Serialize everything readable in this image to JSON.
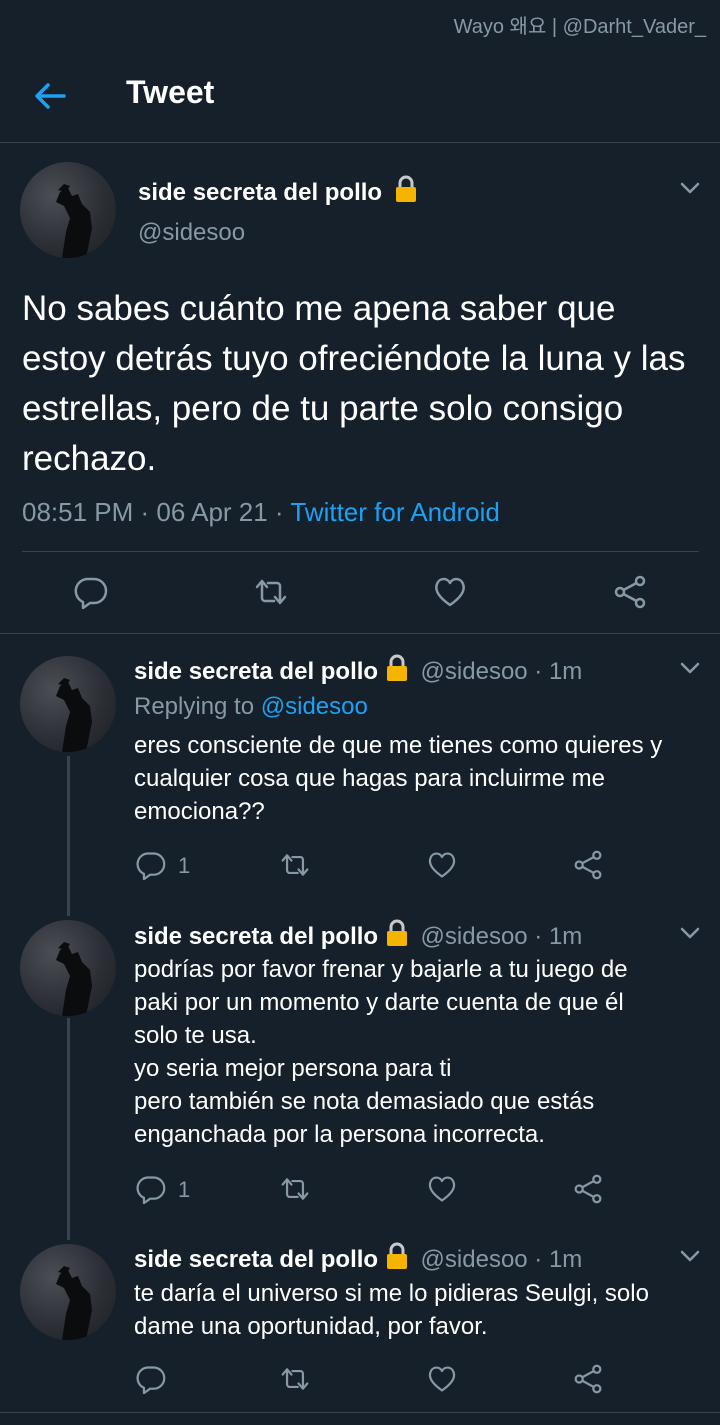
{
  "watermark": "Wayo 왜요 | @Darht_Vader_",
  "header": {
    "title": "Tweet",
    "back_icon": "arrow-left-icon"
  },
  "colors": {
    "background": "#15202b",
    "accent": "#1da1f2",
    "muted": "#8899a6",
    "divider": "#38444d",
    "lock": "#f5b400"
  },
  "main_tweet": {
    "name": "side secreta del pollo",
    "handle": "@sidesoo",
    "text": "No sabes cuánto me apena saber que estoy detrás tuyo ofreciéndote la luna y las estrellas, pero de tu parte solo consigo rechazo.",
    "time": "08:51 PM · 06 Apr 21 · ",
    "source": "Twitter for Android"
  },
  "replies": [
    {
      "name": "side secreta del pollo",
      "handle_time": "@sidesoo · 1m",
      "replying_prefix": "Replying to ",
      "replying_to": "@sidesoo",
      "text": "eres consciente de que me tienes como quieres y cualquier cosa que hagas para incluirme me emociona??",
      "reply_count": "1"
    },
    {
      "name": "side secreta del pollo",
      "handle_time": "@sidesoo · 1m",
      "text_lines": [
        "podrías por favor frenar y bajarle a tu juego de",
        "paki por un momento y darte cuenta de que él",
        "solo te usa.",
        "yo seria mejor persona para ti",
        "pero también se nota demasiado que estás",
        "enganchada por la persona incorrecta."
      ],
      "reply_count": "1"
    },
    {
      "name": "side secreta del pollo",
      "handle_time": "@sidesoo · 1m",
      "text": "te daría el universo si me lo pidieras Seulgi, solo dame una oportunidad, por favor."
    }
  ]
}
